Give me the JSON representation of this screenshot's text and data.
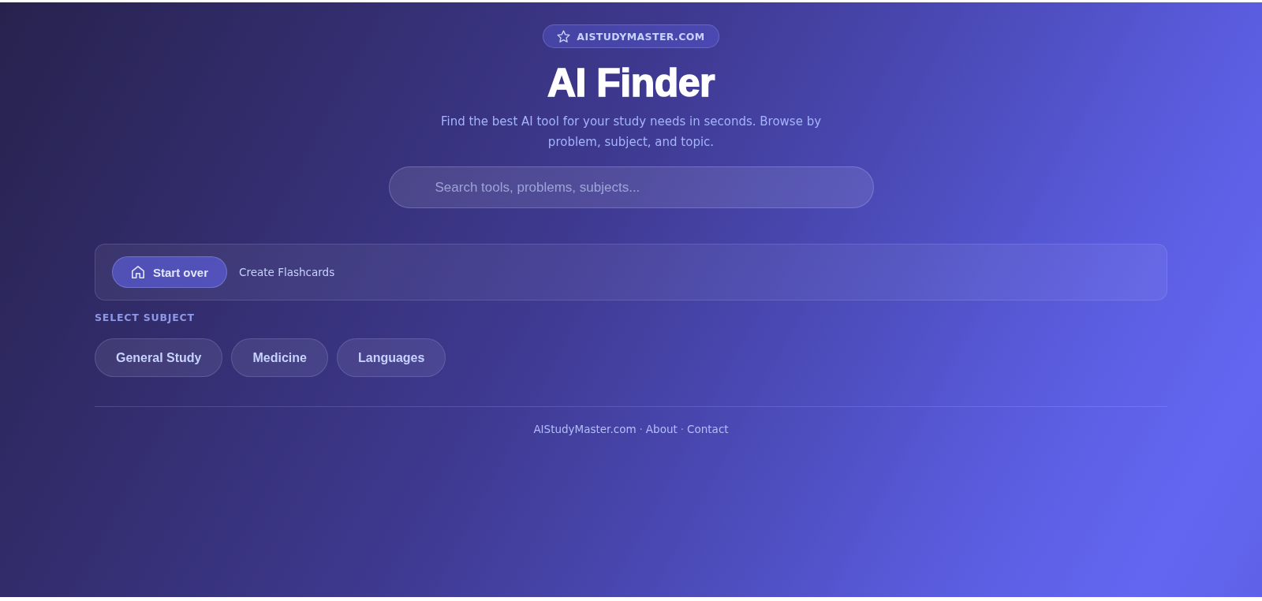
{
  "badge": {
    "text": "AISTUDYMASTER.COM"
  },
  "title": "AI Finder",
  "subtitle": "Find the best AI tool for your study needs in seconds. Browse by problem, subject, and topic.",
  "search": {
    "placeholder": "Search tools, problems, subjects..."
  },
  "breadcrumb": [
    {
      "kind": "home",
      "label": "Start over"
    },
    {
      "kind": "link",
      "label": "Create Flashcards"
    }
  ],
  "subject_section": {
    "heading": "SELECT SUBJECT",
    "subjects": [
      {
        "label": "General Study",
        "selected": false
      },
      {
        "label": "Medicine",
        "selected": false
      },
      {
        "label": "Languages",
        "selected": false
      }
    ]
  },
  "footer": {
    "links": [
      "AIStudyMaster.com",
      "About",
      "Contact"
    ],
    "separator": "·"
  }
}
